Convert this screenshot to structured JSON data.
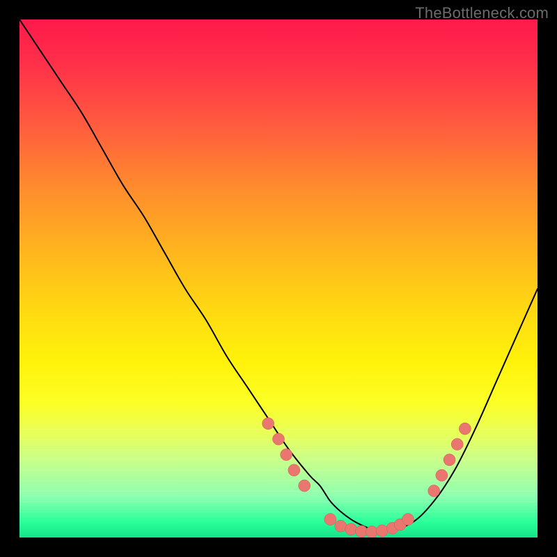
{
  "watermark": "TheBottleneck.com",
  "colors": {
    "background_frame": "#000000",
    "dot_fill": "#e9766f",
    "dot_stroke": "#c95a53",
    "curve": "#000000",
    "gradient_top": "#ff1a4b",
    "gradient_bottom": "#16e38a"
  },
  "chart_data": {
    "type": "line",
    "title": "",
    "xlabel": "",
    "ylabel": "",
    "xlim": [
      0,
      100
    ],
    "ylim": [
      0,
      100
    ],
    "grid": false,
    "legend": false,
    "series": [
      {
        "name": "bottleneck-curve",
        "x": [
          0,
          4,
          8,
          12,
          16,
          20,
          24,
          28,
          32,
          36,
          40,
          44,
          48,
          52,
          56,
          58,
          60,
          62,
          64,
          66,
          68,
          70,
          72,
          76,
          80,
          84,
          88,
          92,
          96,
          100
        ],
        "y": [
          100,
          94,
          88,
          82,
          75,
          68,
          62,
          55,
          48,
          42,
          35,
          29,
          23,
          17,
          12,
          10,
          7,
          5,
          3.5,
          2.4,
          1.6,
          1.2,
          1.5,
          3,
          7,
          13,
          21,
          30,
          39,
          48
        ]
      }
    ],
    "markers": [
      {
        "x": 48,
        "y": 22
      },
      {
        "x": 50,
        "y": 19
      },
      {
        "x": 51.5,
        "y": 16
      },
      {
        "x": 53,
        "y": 13
      },
      {
        "x": 55,
        "y": 10
      },
      {
        "x": 60,
        "y": 3.5
      },
      {
        "x": 62,
        "y": 2.2
      },
      {
        "x": 64,
        "y": 1.6
      },
      {
        "x": 66,
        "y": 1.2
      },
      {
        "x": 68,
        "y": 1.1
      },
      {
        "x": 70,
        "y": 1.3
      },
      {
        "x": 72,
        "y": 1.8
      },
      {
        "x": 73.5,
        "y": 2.5
      },
      {
        "x": 75,
        "y": 3.5
      },
      {
        "x": 80,
        "y": 9
      },
      {
        "x": 81.5,
        "y": 12
      },
      {
        "x": 83,
        "y": 15
      },
      {
        "x": 84.5,
        "y": 18
      },
      {
        "x": 86,
        "y": 21
      }
    ]
  }
}
